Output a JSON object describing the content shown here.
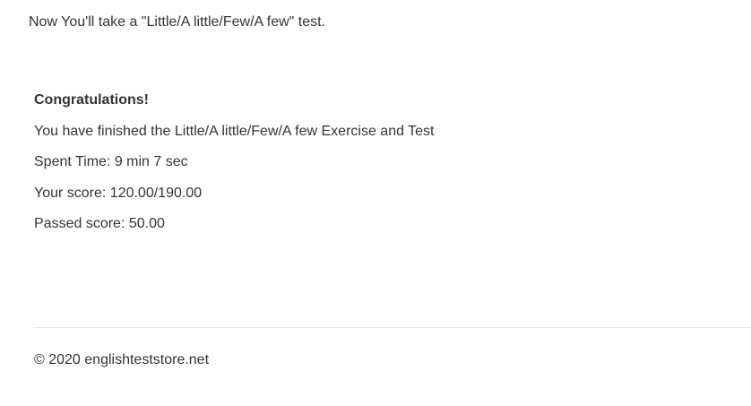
{
  "intro": {
    "text": "Now You'll take a \"Little/A little/Few/A few\" test."
  },
  "result": {
    "heading": "Congratulations!",
    "message": "You have finished the Little/A little/Few/A few Exercise and Test",
    "spent_time": "Spent Time: 9 min 7 sec",
    "your_score": "Your score: 120.00/190.00",
    "passed_score": "Passed score: 50.00"
  },
  "footer": {
    "copyright": "© 2020 englishteststore.net"
  }
}
